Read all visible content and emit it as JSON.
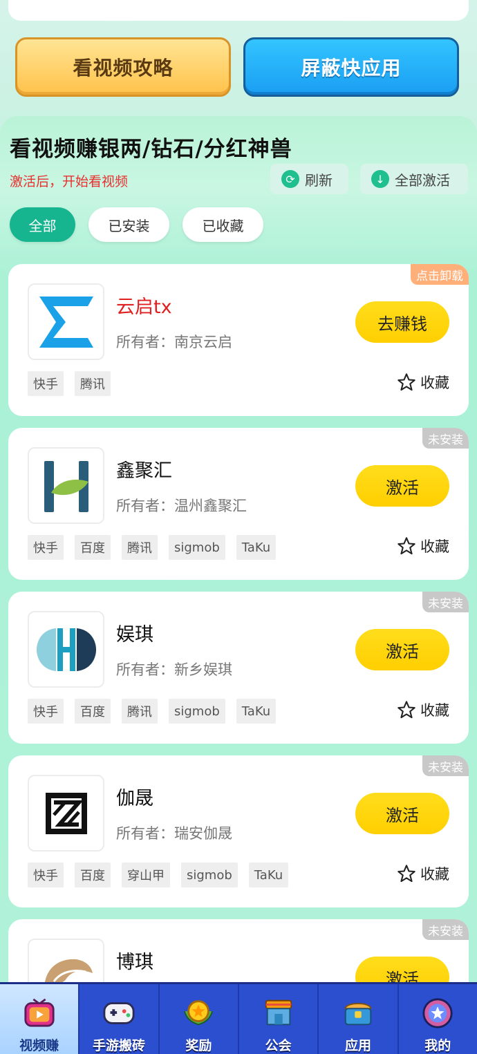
{
  "guide_button": "看视频攻略",
  "block_button": "屏蔽快应用",
  "section": {
    "title": "看视频赚银两/钻石/分红神兽",
    "subtitle": "激活后，开始看视频",
    "refresh": "刷新",
    "activate_all": "全部激活"
  },
  "filters": [
    {
      "label": "全部",
      "active": true
    },
    {
      "label": "已安装",
      "active": false
    },
    {
      "label": "已收藏",
      "active": false
    }
  ],
  "apps": [
    {
      "name": "云启tx",
      "owner": "所有者：南京云启",
      "badge": "点击卸载",
      "action": "去赚钱",
      "tags": [
        "快手",
        "腾讯"
      ],
      "fav": "收藏"
    },
    {
      "name": "鑫聚汇",
      "owner": "所有者：温州鑫聚汇",
      "badge": "未安装",
      "action": "激活",
      "tags": [
        "快手",
        "百度",
        "腾讯",
        "sigmob",
        "TaKu"
      ],
      "fav": "收藏"
    },
    {
      "name": "娱琪",
      "owner": "所有者：新乡娱琪",
      "badge": "未安装",
      "action": "激活",
      "tags": [
        "快手",
        "百度",
        "腾讯",
        "sigmob",
        "TaKu"
      ],
      "fav": "收藏"
    },
    {
      "name": "伽晟",
      "owner": "所有者：瑞安伽晟",
      "badge": "未安装",
      "action": "激活",
      "tags": [
        "快手",
        "百度",
        "穿山甲",
        "sigmob",
        "TaKu"
      ],
      "fav": "收藏"
    },
    {
      "name": "博琪",
      "owner": "",
      "badge": "未安装",
      "action": "激活",
      "tags": [],
      "fav": ""
    }
  ],
  "nav": [
    {
      "label": "视频赚",
      "active": true
    },
    {
      "label": "手游搬砖",
      "active": false
    },
    {
      "label": "奖励",
      "active": false
    },
    {
      "label": "公会",
      "active": false
    },
    {
      "label": "应用",
      "active": false
    },
    {
      "label": "我的",
      "active": false
    }
  ]
}
